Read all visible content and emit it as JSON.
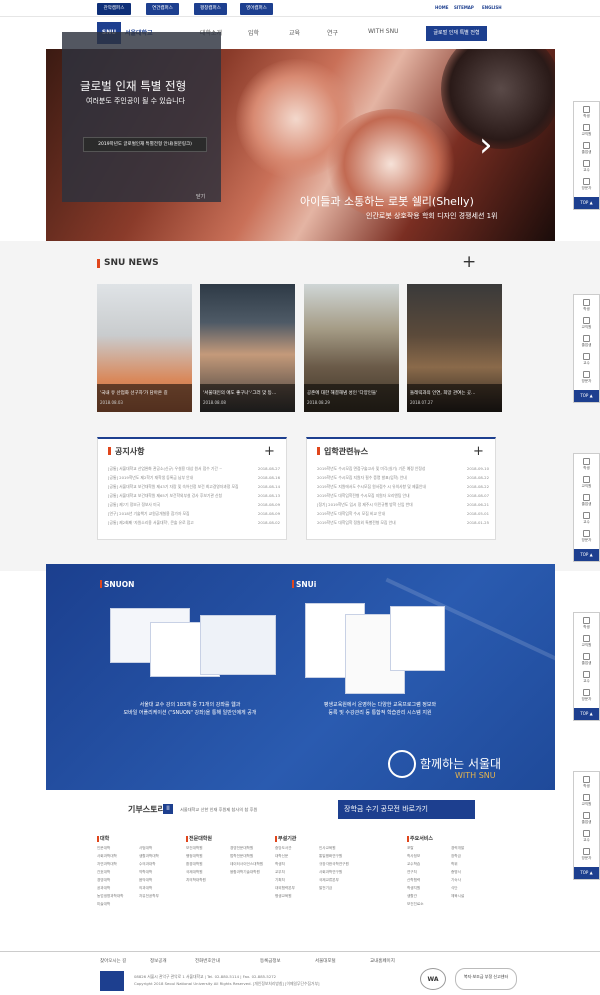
{
  "topbar": {
    "tabs": [
      "관악캠퍼스",
      "연건캠퍼스",
      "평창캠퍼스",
      "영어캠퍼스"
    ],
    "right": [
      "HOME",
      "SITEMAP",
      "ENGLISH"
    ]
  },
  "header": {
    "logo_text": "서울대학교",
    "nav": [
      "대학소개",
      "입학",
      "교육",
      "연구",
      "WITH SNU"
    ],
    "button": "글로벌 인재 특별 전형"
  },
  "hero": {
    "overlay_title": "글로벌 인재 특별 전형",
    "overlay_sub": "여러분도 주인공이 될 수 있습니다",
    "overlay_btn": "2019학년도 글로벌인재 특별전형 안내(원문링크)",
    "overlay_close": "닫기",
    "caption1": "아이들과 소통하는 로봇 쉘리(Shelly)",
    "caption2": "인간로봇 상호작용 학회 디자인 경쟁세션 1위",
    "next_arrow": "›"
  },
  "quick_menu": {
    "items": [
      "학생",
      "교직원",
      "졸업생",
      "교수",
      "방문자"
    ],
    "top": "TOP ▲"
  },
  "news": {
    "title": "SNU NEWS",
    "plus": "+",
    "cards": [
      {
        "title": "'국내 유 산업화 선구자'가 담아온 길",
        "date": "2018.08.03"
      },
      {
        "title": "'서울대인의 애도 좋구나'·'그러 맞 등…",
        "date": "2018.08.08"
      },
      {
        "title": "공존에 대한 해결해냄 성인 '다양인들'",
        "date": "2018.08.29"
      },
      {
        "title": "돌레릭과의 인연, 희망 관여는 곳…",
        "date": "2018.07.27"
      }
    ]
  },
  "notices": {
    "title": "공지사항",
    "plus": "+",
    "rows": [
      {
        "t": "[공통] 서울대학교 산업완화 관공소(신규) 우설용 대상 원서 접수 기간 ~",
        "d": "2018-08-27"
      },
      {
        "t": "[공통] 2019학년도 제2학기 재학생 등록금 납부 안내",
        "d": "2018-08-16"
      },
      {
        "t": "[공통] 서울대학교 보건대학원 제43기 자랑 및 숙어선정 보건 최고경영자과정 모집",
        "d": "2018-08-14"
      },
      {
        "t": "[공통] 서울대학교 보건대학원 제65기 보건학외부설 강사 후보기관 신청",
        "d": "2018-08-13"
      },
      {
        "t": "[공통] 제7기 정보규 정보사 미국",
        "d": "2018-08-09"
      },
      {
        "t": "[연구] 2018년 기술책기 교원공개칠용 참가자 모집",
        "d": "2018-08-09"
      },
      {
        "t": "[공통] 제2회째 '자원소리용 서울대학', 콘솔 유로 접고",
        "d": "2018-08-02"
      }
    ]
  },
  "admissions": {
    "title": "입학관련뉴스",
    "plus": "+",
    "rows": [
      {
        "t": "2019학년도 수시모집 면접구술고사 및 미각(실기) 기준 예정 안정성",
        "d": "2018-09-10"
      },
      {
        "t": "2019학년도 수시모집 지원자 필수 증명 발표(입학) 안내",
        "d": "2018-08-22"
      },
      {
        "t": "2019학년도 지원에서도 수시모집 원서접수 시 유의사항 및 제출안내",
        "d": "2018-08-22"
      },
      {
        "t": "2019학년도 대학입학전형 수시모집 지원자 오리엔팅 안내",
        "d": "2018-08-07"
      },
      {
        "t": "[정기] 2019학년도 입시 정 제주시 이민규행 방학 신입 반대",
        "d": "2018-06-21"
      },
      {
        "t": "2019학년도 대학입학 수시 모집 비교 안내",
        "d": "2018-05-01"
      },
      {
        "t": "2019학년도 대학입학 정원외 특별전형 모집 안내",
        "d": "2018-01-25"
      }
    ]
  },
  "media": {
    "snuon_title": "SNUON",
    "snuon_desc1": "서울대 교수 강의 183개 중 71개의 강좌를 웹과",
    "snuon_desc2": "모바일 어플리케이션 (\"SNUON\" 강좌)을 통해 일반인에게 공개",
    "snui_title": "SNUi",
    "snui_desc1": "평생교육원에서 운영하는 다양한 교육프로그램 정보와",
    "snui_desc2": "등록 및 수강관리 등 통합적 학습관리 시스템 지원",
    "with_kr": "함께하는 서울대",
    "with_en": "WITH SNU"
  },
  "story": {
    "title": "기부스토리",
    "icon": "II",
    "text": "서울대학교 산한 인재 후원제 참사의 참 후원",
    "button": "장학금 수기 공모전 바로가기"
  },
  "sitemap": {
    "cols": [
      {
        "h": "대학",
        "items": [
          "인문대학",
          "사회과학대학",
          "자연과학대학",
          "간호대학",
          "경영대학",
          "공과대학",
          "농업생명과학대학",
          "미술대학",
          "사범대학",
          "생활과학대학",
          "수의과대학",
          "약학대학",
          "음악대학",
          "의과대학",
          "자유전공학부"
        ]
      },
      {
        "h": "전문대학원",
        "items": [
          "보건대학원",
          "행정대학원",
          "환경대학원",
          "국제대학원",
          "치의학대학원",
          "경영전문대학원",
          "법학전문대학원",
          "데이터사이언스대학원",
          "융합과학기술대학원"
        ]
      },
      {
        "h": "부설기관",
        "items": [
          "중앙도서관",
          "대학신문",
          "학생처",
          "교무처",
          "기획처",
          "대외협력본부",
          "평생교육원",
          "인사교육원",
          "통일평화연구원",
          "규장각한국학연구원",
          "사회과학연구원",
          "국제교류본부",
          "발전기금"
        ]
      },
      {
        "h": "주요서비스",
        "items": [
          "포탈",
          "학사정보",
          "교수학습",
          "연구처",
          "산학협력",
          "학생지원",
          "생활관",
          "보건진료소",
          "경력개발",
          "장학금",
          "학위",
          "증명서",
          "기숙사",
          "식단",
          "체육시설"
        ]
      }
    ]
  },
  "footer": {
    "links": [
      "찾아오시는 길",
      "정보공개",
      "전화번호안내",
      "등록금정보",
      "서울대포털",
      "교내홈페이지"
    ],
    "addr1": "08826 서울시 관악구 관악로 1 서울대학교 | Tel. 02-880-5114 | Fax. 02-885-5272",
    "addr2": "Copyright 2018 Seoul National University All Rights Reserved. [개인정보처리방침] [이메일무단수집거부]",
    "badge1": "WA",
    "badge2": "복지·보조금 부정 신고센터"
  }
}
